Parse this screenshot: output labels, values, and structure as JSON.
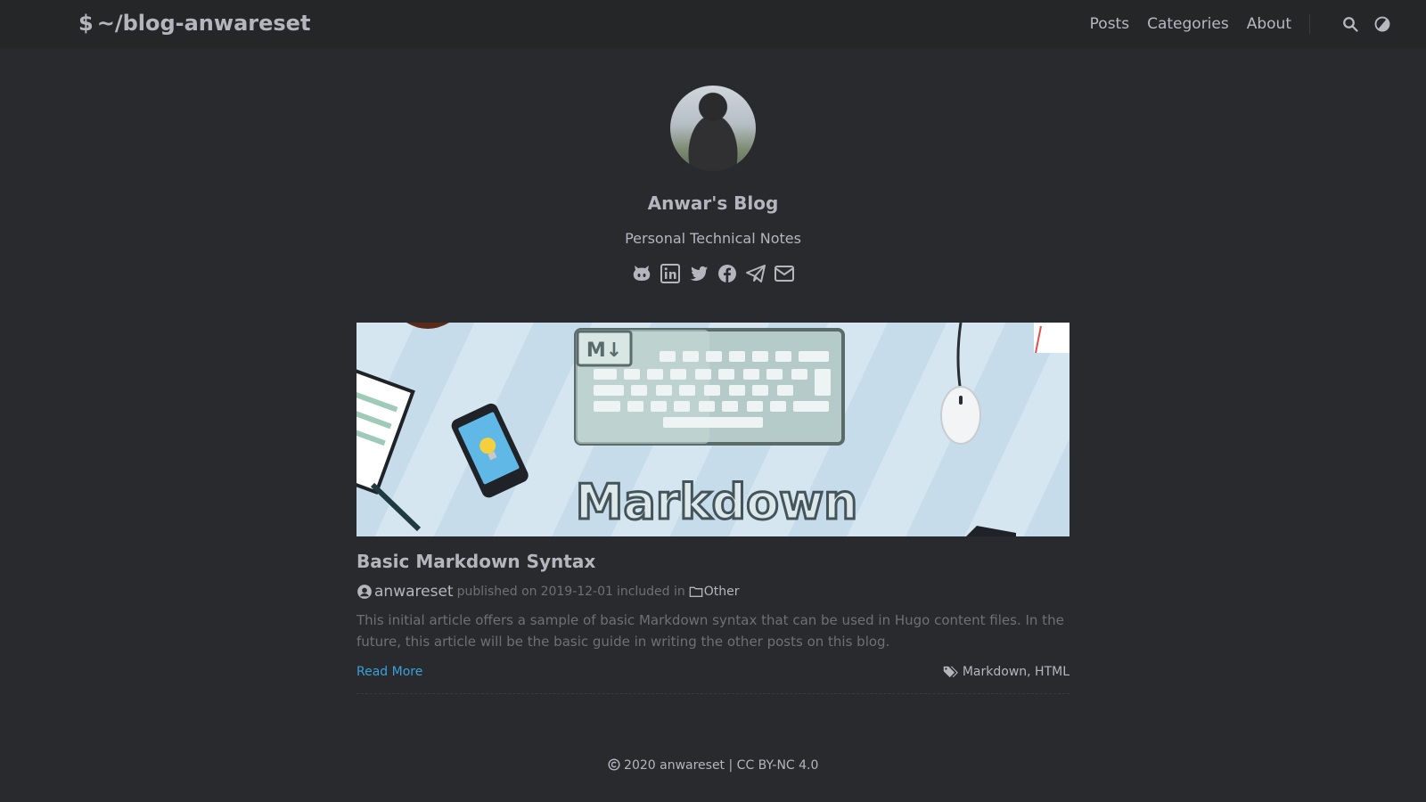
{
  "header": {
    "logo_symbol": "$",
    "logo_text": "~/blog-anwareset",
    "nav": [
      {
        "label": "Posts"
      },
      {
        "label": "Categories"
      },
      {
        "label": "About"
      }
    ],
    "icons": [
      "search-icon",
      "theme-toggle-icon"
    ]
  },
  "profile": {
    "title": "Anwar's Blog",
    "subtitle": "Personal Technical Notes",
    "social_icons": [
      "github-icon",
      "linkedin-icon",
      "twitter-icon",
      "facebook-icon",
      "telegram-icon",
      "mail-icon"
    ]
  },
  "post": {
    "cover_text": "Markdown",
    "cover_badge": "M↓",
    "title": "Basic Markdown Syntax",
    "author": "anwareset",
    "published_prefix": "published on",
    "date": "2019-12-01",
    "included_prefix": "included in",
    "category": "Other",
    "summary": "This initial article offers a sample of basic Markdown syntax that can be used in Hugo content files. In the future, this article will be the basic guide in writing the other posts on this blog.",
    "read_more": "Read More",
    "tags": "Markdown, HTML"
  },
  "footer": {
    "text": "2020 anwareset | CC BY-NC 4.0"
  },
  "colors": {
    "background": "#292a2d",
    "header": "#252627",
    "accent_link": "#3aa0d9"
  }
}
